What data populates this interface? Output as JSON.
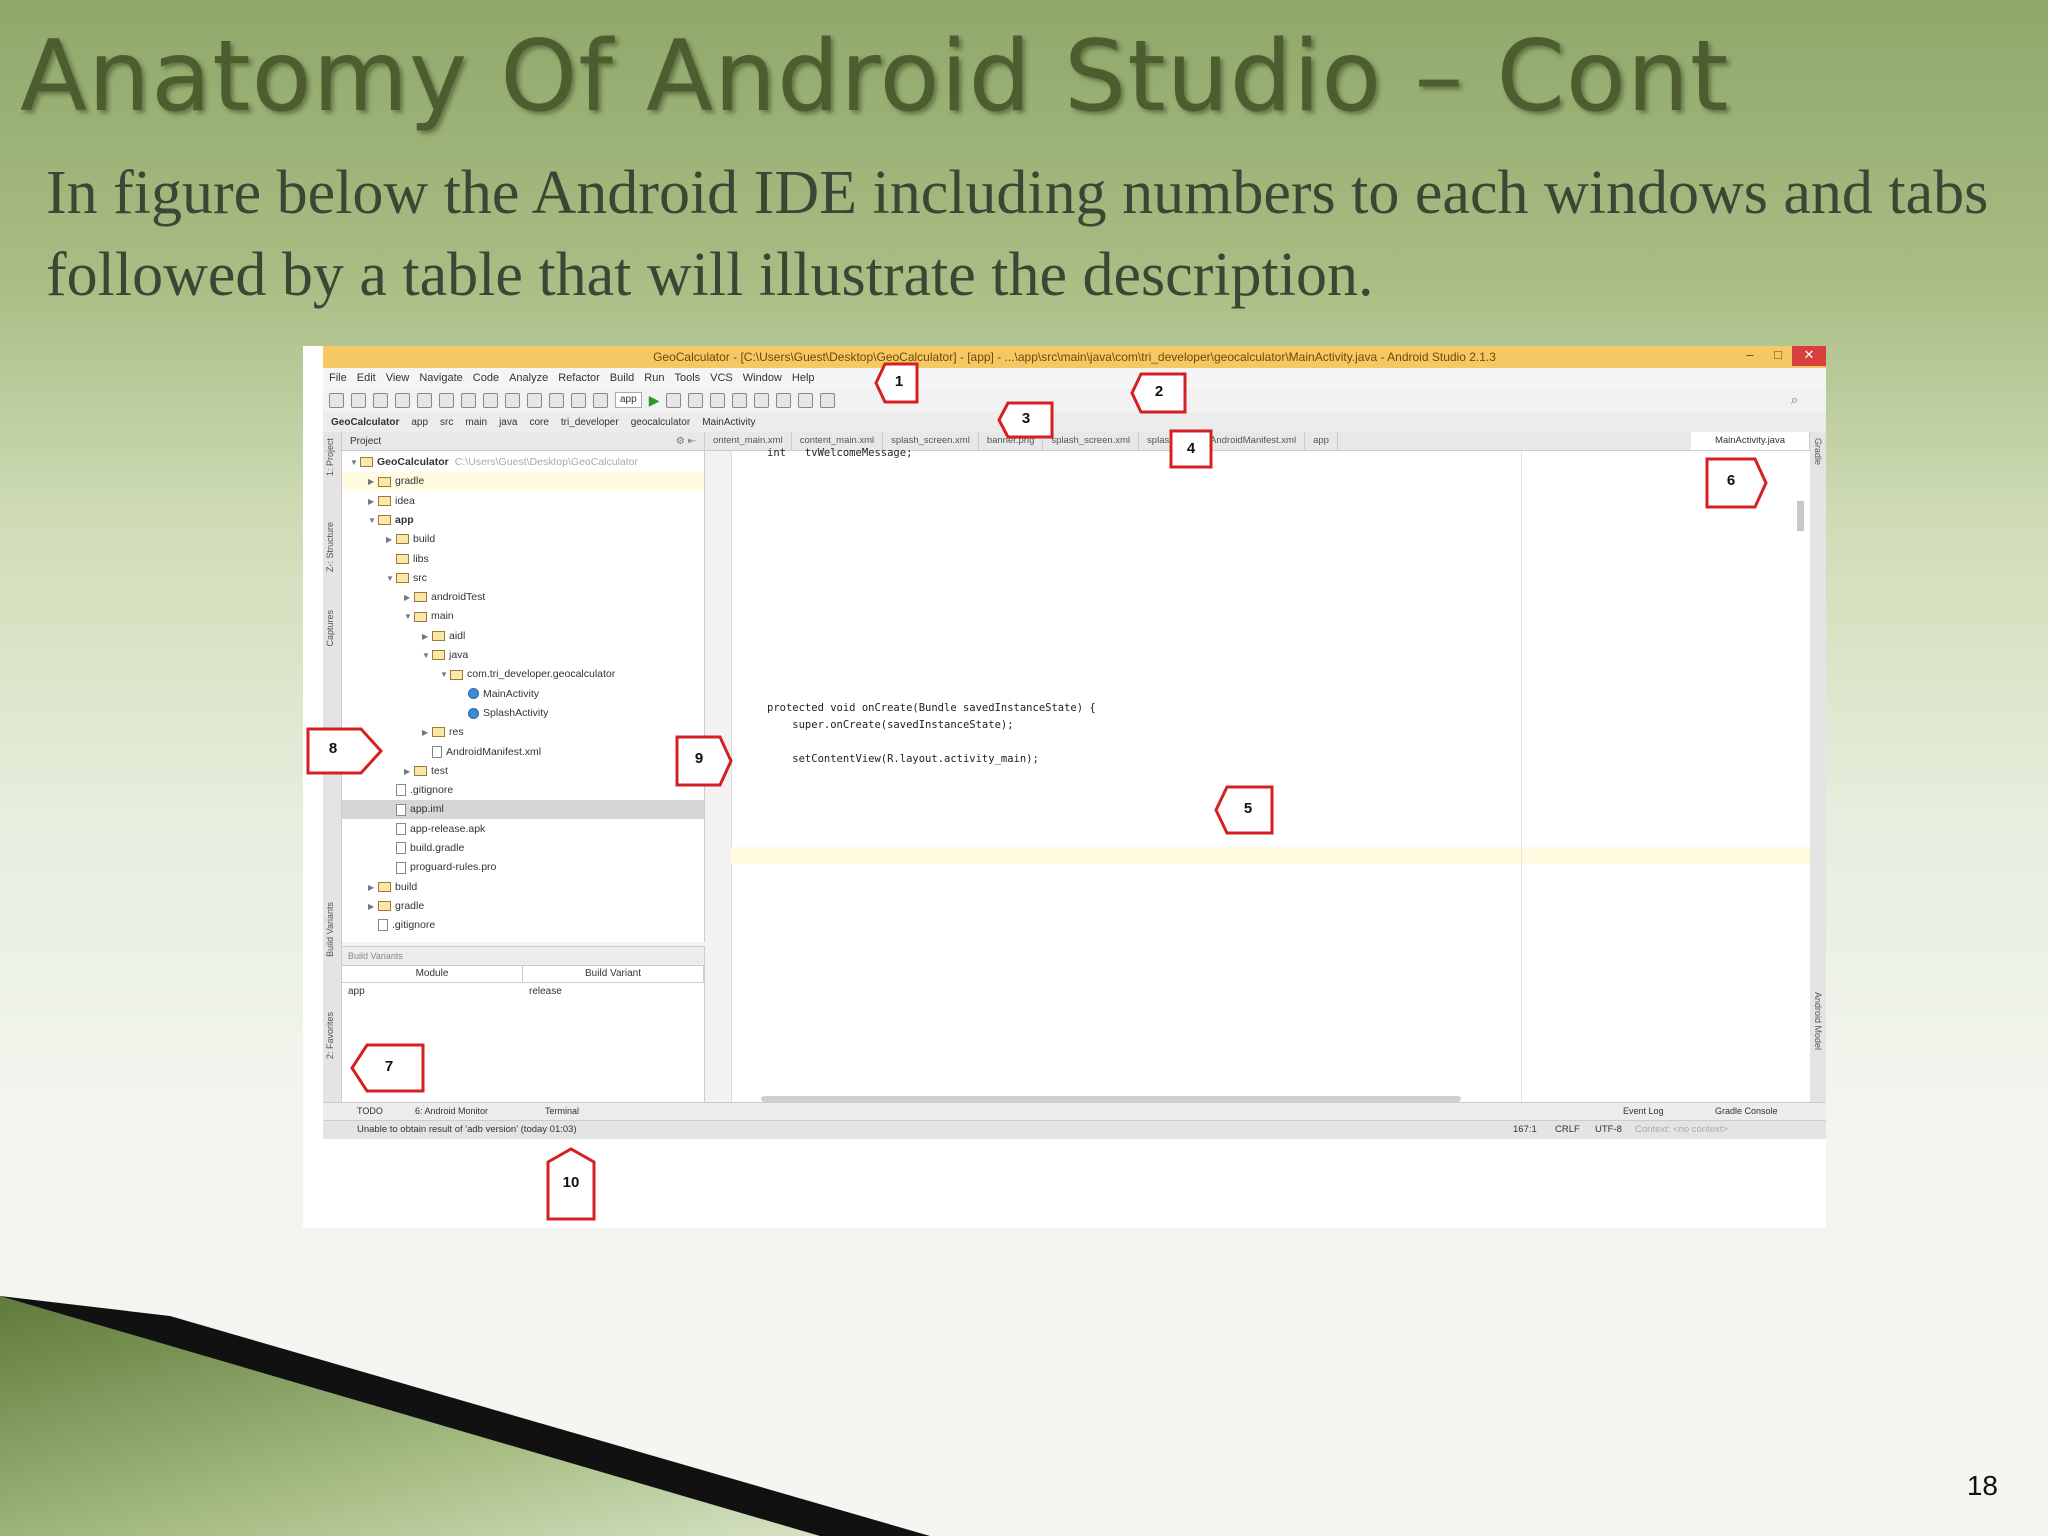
{
  "slide": {
    "title": "Anatomy Of Android Studio – Cont",
    "subtitle": "In figure below the Android IDE including numbers to each windows and tabs followed by a table that will illustrate the description.",
    "page_number": "18"
  },
  "ide": {
    "window_title": "GeoCalculator - [C:\\Users\\Guest\\Desktop\\GeoCalculator] - [app] - ...\\app\\src\\main\\java\\com\\tri_developer\\geocalculator\\MainActivity.java - Android Studio 2.1.3",
    "window_buttons": [
      "–",
      "□",
      "✕"
    ],
    "menu": [
      "File",
      "Edit",
      "View",
      "Navigate",
      "Code",
      "Analyze",
      "Refactor",
      "Build",
      "Run",
      "Tools",
      "VCS",
      "Window",
      "Help"
    ],
    "toolbar": {
      "run_config": "app",
      "run_icon": "▶",
      "search_icon": "⌕"
    },
    "breadcrumbs": [
      "GeoCalculator",
      "app",
      "src",
      "main",
      "java",
      "core",
      "tri_developer",
      "geocalculator",
      "MainActivity"
    ],
    "left_tool_tabs": [
      "1: Project",
      "Z-: Structure",
      "Captures",
      "Build Variants",
      "2: Favorites"
    ],
    "right_tool_tabs": [
      "Gradle",
      "Android Model"
    ],
    "project_panel": {
      "header": "Project",
      "tree": [
        {
          "label": "GeoCalculator",
          "hint": "C:\\Users\\Guest\\Desktop\\GeoCalculator",
          "depth": 0,
          "arrow": "▼",
          "kind": "folder",
          "bold": true
        },
        {
          "label": "gradle",
          "depth": 1,
          "arrow": "▶",
          "kind": "folder",
          "hl": true
        },
        {
          "label": "idea",
          "depth": 1,
          "arrow": "▶",
          "kind": "folder"
        },
        {
          "label": "app",
          "depth": 1,
          "arrow": "▼",
          "kind": "folder",
          "bold": true
        },
        {
          "label": "build",
          "depth": 2,
          "arrow": "▶",
          "kind": "folder"
        },
        {
          "label": "libs",
          "depth": 2,
          "arrow": "",
          "kind": "folder"
        },
        {
          "label": "src",
          "depth": 2,
          "arrow": "▼",
          "kind": "folder"
        },
        {
          "label": "androidTest",
          "depth": 3,
          "arrow": "▶",
          "kind": "folder"
        },
        {
          "label": "main",
          "depth": 3,
          "arrow": "▼",
          "kind": "folder"
        },
        {
          "label": "aidl",
          "depth": 4,
          "arrow": "▶",
          "kind": "folder"
        },
        {
          "label": "java",
          "depth": 4,
          "arrow": "▼",
          "kind": "folder"
        },
        {
          "label": "com.tri_developer.geocalculator",
          "depth": 5,
          "arrow": "▼",
          "kind": "folder"
        },
        {
          "label": "MainActivity",
          "depth": 6,
          "arrow": "",
          "kind": "cls"
        },
        {
          "label": "SplashActivity",
          "depth": 6,
          "arrow": "",
          "kind": "cls"
        },
        {
          "label": "res",
          "depth": 4,
          "arrow": "▶",
          "kind": "folder"
        },
        {
          "label": "AndroidManifest.xml",
          "depth": 4,
          "arrow": "",
          "kind": "file"
        },
        {
          "label": "test",
          "depth": 3,
          "arrow": "▶",
          "kind": "folder"
        },
        {
          "label": ".gitignore",
          "depth": 2,
          "arrow": "",
          "kind": "file"
        },
        {
          "label": "app.iml",
          "depth": 2,
          "arrow": "",
          "kind": "file",
          "sel": true
        },
        {
          "label": "app-release.apk",
          "depth": 2,
          "arrow": "",
          "kind": "file"
        },
        {
          "label": "build.gradle",
          "depth": 2,
          "arrow": "",
          "kind": "file"
        },
        {
          "label": "proguard-rules.pro",
          "depth": 2,
          "arrow": "",
          "kind": "file"
        },
        {
          "label": "build",
          "depth": 1,
          "arrow": "▶",
          "kind": "folder"
        },
        {
          "label": "gradle",
          "depth": 1,
          "arrow": "▶",
          "kind": "folder"
        },
        {
          "label": ".gitignore",
          "depth": 1,
          "arrow": "",
          "kind": "file"
        }
      ]
    },
    "build_variants": {
      "header": "Build Variants",
      "columns": [
        "Module",
        "Build Variant"
      ],
      "row": [
        "app",
        "release"
      ]
    },
    "editor_tabs": [
      "ontent_main.xml",
      "content_main.xml",
      "splash_screen.xml",
      "banner.png",
      "splash_screen.xml",
      "splash.png",
      "AndroidManifest.xml",
      "app",
      "MainActivity.java"
    ],
    "code_lines": [
      {
        "text": "int   tvWelcomeMessage;",
        "row": 0
      },
      {
        "text": "protected void onCreate(Bundle savedInstanceState) {",
        "row": 15
      },
      {
        "text": "    super.onCreate(savedInstanceState);",
        "row": 16
      },
      {
        "text": "    setContentView(R.layout.activity_main);",
        "row": 18
      }
    ],
    "bottom_tabs": [
      "TODO",
      "6: Android Monitor",
      "Terminal",
      "Event Log",
      "Gradle Console"
    ],
    "status": {
      "message": "Unable to obtain result of 'adb version' (today 01:03)",
      "position": "167:1",
      "line_sep": "CRLF",
      "encoding": "UTF-8",
      "context": "Context: <no context>"
    }
  },
  "callouts": [
    "1",
    "2",
    "3",
    "4",
    "5",
    "6",
    "7",
    "8",
    "9",
    "10"
  ],
  "colors": {
    "title": "#4d5d2f",
    "callout_stroke": "#d42020",
    "ide_titlebar": "#f6c864"
  }
}
